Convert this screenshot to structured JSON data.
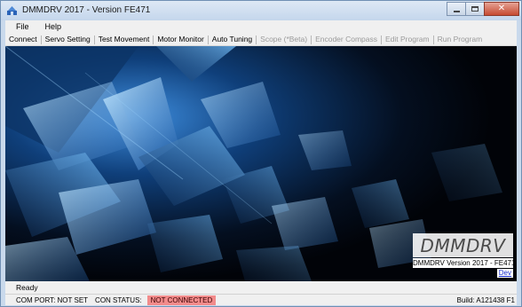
{
  "window": {
    "title": "DMMDRV 2017 - Version FE471",
    "icon": "app-icon",
    "controls": [
      "minimize-icon",
      "maximize-icon",
      "close-icon"
    ],
    "colors": {
      "frame": "#c9d9ec",
      "close": "#c64a31"
    }
  },
  "menu": {
    "items": [
      {
        "label": "File"
      },
      {
        "label": "Help"
      }
    ]
  },
  "toolbar": {
    "buttons": [
      {
        "label": "Connect",
        "enabled": true
      },
      {
        "label": "Servo Setting",
        "enabled": true
      },
      {
        "label": "Test Movement",
        "enabled": true
      },
      {
        "label": "Motor Monitor",
        "enabled": true
      },
      {
        "label": "Auto Tuning",
        "enabled": true
      },
      {
        "label": "Scope (*Beta)",
        "enabled": false
      },
      {
        "label": "Encoder Compass",
        "enabled": false
      },
      {
        "label": "Edit Program",
        "enabled": false
      },
      {
        "label": "Run Program",
        "enabled": false
      }
    ]
  },
  "splash": {
    "logo": "DMMDRV",
    "version": "DMMDRV Version 2017 - FE471",
    "dev_link": "Dev"
  },
  "status": {
    "message": "Ready",
    "com_port": "COM PORT: NOT SET",
    "con_status_label": "CON STATUS:",
    "con_status_value": "NOT CONNECTED",
    "con_status_color": "#f28b8b",
    "build": "Build: A121438 F1"
  }
}
